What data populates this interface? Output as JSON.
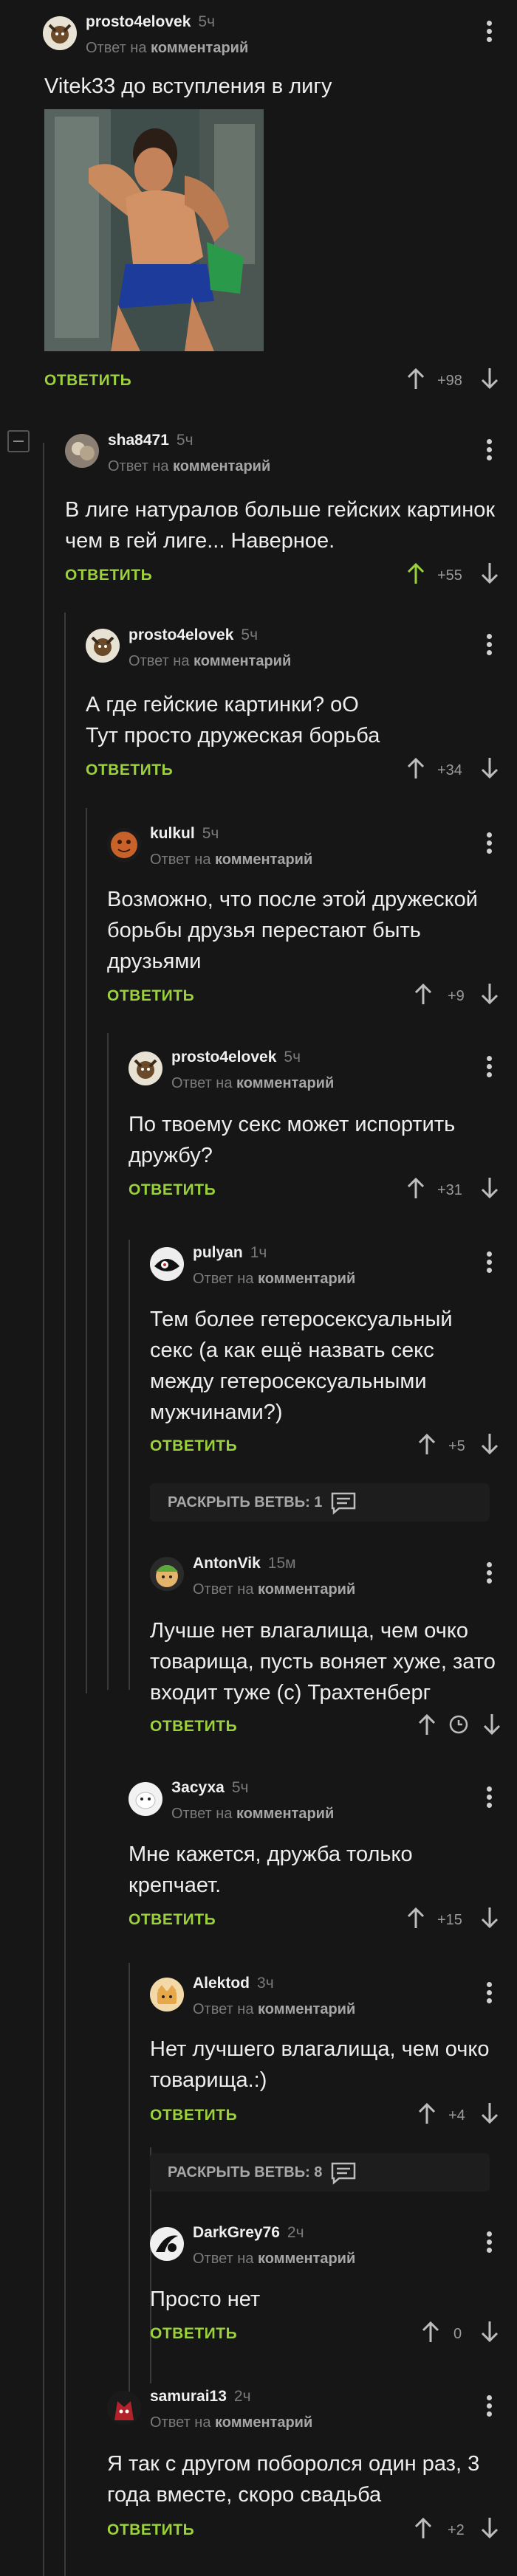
{
  "comments": [
    {
      "user": "prosto4elovek",
      "time": "5ч",
      "reply_prefix": "Ответ на",
      "reply_link": "комментарий",
      "lines": [
        "Vitek33 до вступления в лигу"
      ],
      "reply": "ОТВЕТИТЬ",
      "votes": "+98",
      "has_image": true,
      "image_alt": "wrestlers in locker room"
    },
    {
      "user": "sha8471",
      "time": "5ч",
      "reply_prefix": "Ответ на",
      "reply_link": "комментарий",
      "lines": [
        "В лиге натуралов больше гейских картинок",
        "чем в гей лиге... Наверное."
      ],
      "reply": "ОТВЕТИТЬ",
      "votes": "+55",
      "upvoted": true
    },
    {
      "user": "prosto4elovek",
      "time": "5ч",
      "reply_prefix": "Ответ на",
      "reply_link": "комментарий",
      "lines": [
        "А где гейские картинки? оО",
        "Тут просто дружеская борьба"
      ],
      "reply": "ОТВЕТИТЬ",
      "votes": "+34"
    },
    {
      "user": "kulkul",
      "time": "5ч",
      "reply_prefix": "Ответ на",
      "reply_link": "комментарий",
      "lines": [
        "Возможно, что после этой дружеской",
        "борьбы друзья перестают быть",
        "друзьями"
      ],
      "reply": "ОТВЕТИТЬ",
      "votes": "+9"
    },
    {
      "user": "prosto4elovek",
      "time": "5ч",
      "reply_prefix": "Ответ на",
      "reply_link": "комментарий",
      "lines": [
        "По твоему секс может испортить",
        "дружбу?"
      ],
      "reply": "ОТВЕТИТЬ",
      "votes": "+31"
    },
    {
      "user": "pulyan",
      "time": "1ч",
      "reply_prefix": "Ответ на",
      "reply_link": "комментарий",
      "lines": [
        "Тем более гетеросексуальный",
        "секс (а как ещё назвать секс",
        "между гетеросексуальными",
        "мужчинами?)"
      ],
      "reply": "ОТВЕТИТЬ",
      "votes": "+5"
    },
    {
      "user": "AntonVik",
      "time": "15м",
      "reply_prefix": "Ответ на",
      "reply_link": "комментарий",
      "lines": [
        "Лучше нет влагалища, чем очко",
        "товарища, пусть воняет хуже, зато",
        "входит туже (с) Трахтенберг"
      ],
      "reply": "ОТВЕТИТЬ",
      "votes": ""
    },
    {
      "user": "Засуха",
      "time": "5ч",
      "reply_prefix": "Ответ на",
      "reply_link": "комментарий",
      "lines": [
        "Мне кажется, дружба только",
        "крепчает."
      ],
      "reply": "ОТВЕТИТЬ",
      "votes": "+15"
    },
    {
      "user": "Alektod",
      "time": "3ч",
      "reply_prefix": "Ответ на",
      "reply_link": "комментарий",
      "lines": [
        "Нет лучшего влагалища, чем очко",
        "товарища.:)"
      ],
      "reply": "ОТВЕТИТЬ",
      "votes": "+4"
    },
    {
      "user": "DarkGrey76",
      "time": "2ч",
      "reply_prefix": "Ответ на",
      "reply_link": "комментарий",
      "lines": [
        "Просто нет"
      ],
      "reply": "ОТВЕТИТЬ",
      "votes": "0"
    },
    {
      "user": "samurai13",
      "time": "2ч",
      "reply_prefix": "Ответ на",
      "reply_link": "комментарий",
      "lines": [
        "Я так с другом поборолся один раз, 3",
        "года вместе, скоро свадьба"
      ],
      "reply": "ОТВЕТИТЬ",
      "votes": "+2"
    }
  ],
  "expand_branches": [
    {
      "label": "РАСКРЫТЬ ВЕТВЬ: 1"
    },
    {
      "label": "РАСКРЫТЬ ВЕТВЬ: 8"
    }
  ],
  "colors": {
    "accent": "#9bd13a",
    "background": "#161616",
    "muted": "#7a7a7a"
  }
}
